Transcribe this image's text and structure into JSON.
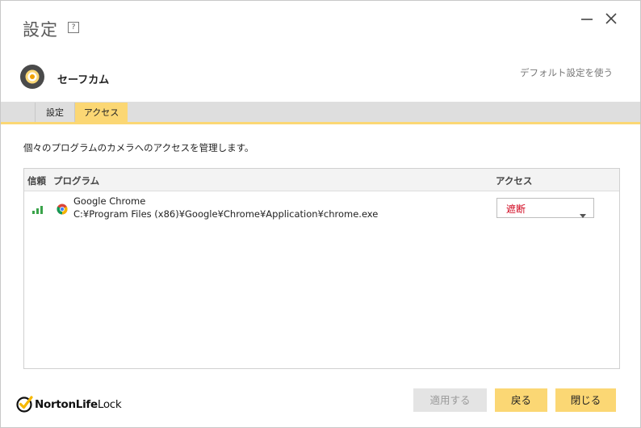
{
  "window": {
    "title": "設定",
    "help_glyph": "?",
    "minimize_icon": "minimize-icon",
    "close_icon": "close-icon"
  },
  "feature": {
    "name": "セーフカム",
    "default_link": "デフォルト設定を使う",
    "icon": "webcam-icon"
  },
  "tabs": [
    {
      "label": "設定",
      "active": false
    },
    {
      "label": "アクセス",
      "active": true
    }
  ],
  "description": "個々のプログラムのカメラへのアクセスを管理します。",
  "table": {
    "headers": {
      "trust": "信頼",
      "program": "プログラム",
      "access": "アクセス"
    },
    "rows": [
      {
        "trust_icon": "trust-signal-icon",
        "program_icon": "chrome-icon",
        "name": "Google Chrome",
        "path": "C:¥Program Files (x86)¥Google¥Chrome¥Application¥chrome.exe",
        "access": "遮断"
      }
    ]
  },
  "footer": {
    "logo_bold": "NortonLife",
    "logo_light": "Lock",
    "apply": "適用する",
    "back": "戻る",
    "close": "閉じる"
  },
  "colors": {
    "accent": "#fbd774",
    "blocked_text": "#d0021b",
    "trust_green": "#3aa34a",
    "disabled_button": "#e4e4e4"
  }
}
